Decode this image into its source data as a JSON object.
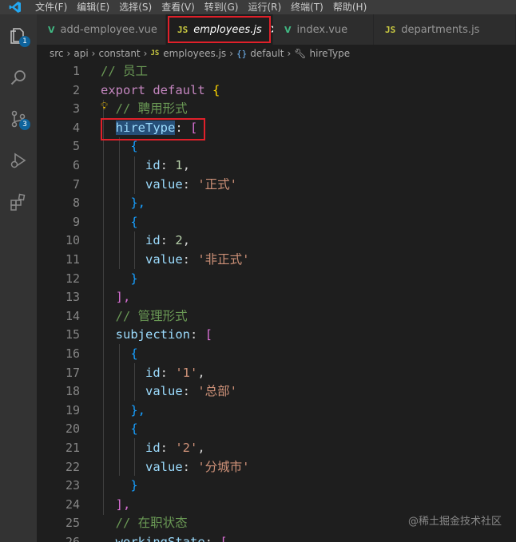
{
  "menubar": {
    "items": [
      "文件(F)",
      "编辑(E)",
      "选择(S)",
      "查看(V)",
      "转到(G)",
      "运行(R)",
      "终端(T)",
      "帮助(H)"
    ]
  },
  "activity": {
    "explorer_badge": "1",
    "scm_badge": "3"
  },
  "tabs": [
    {
      "icon": "V",
      "name": "add-employee.vue",
      "modified": true
    },
    {
      "icon": "JS",
      "name": "employees.js",
      "active": true
    },
    {
      "icon": "V",
      "name": "index.vue"
    },
    {
      "icon": "JS",
      "name": "departments.js"
    }
  ],
  "breadcrumb": {
    "parts": [
      "src",
      "api",
      "constant"
    ],
    "file_icon": "JS",
    "file": "employees.js",
    "symbol_icon": "{}",
    "symbol": "default",
    "leaf": "hireType"
  },
  "code": {
    "line_numbers": [
      "1",
      "2",
      "3",
      "4",
      "5",
      "6",
      "7",
      "8",
      "9",
      "10",
      "11",
      "12",
      "13",
      "14",
      "15",
      "16",
      "17",
      "18",
      "19",
      "20",
      "21",
      "22",
      "23",
      "24",
      "25",
      "26"
    ],
    "l1": "// 员工",
    "l2_kw": "export",
    "l2_kw2": "default",
    "l2_brace": "{",
    "l3": "// 聘用形式",
    "l4_prop": "hireType",
    "l4_rest": ": ",
    "l4_br": "[",
    "l5": "{",
    "l6_prop": "id",
    "l6_sep": ": ",
    "l6_val": "1",
    "l6_end": ",",
    "l7_prop": "value",
    "l7_sep": ": ",
    "l7_val": "'正式'",
    "l8": "},",
    "l9": "{",
    "l10_prop": "id",
    "l10_sep": ": ",
    "l10_val": "2",
    "l10_end": ",",
    "l11_prop": "value",
    "l11_sep": ": ",
    "l11_val": "'非正式'",
    "l12": "}",
    "l13": "],",
    "l14": "// 管理形式",
    "l15_prop": "subjection",
    "l15_sep": ": ",
    "l15_br": "[",
    "l16": "{",
    "l17_prop": "id",
    "l17_sep": ": ",
    "l17_val": "'1'",
    "l17_end": ",",
    "l18_prop": "value",
    "l18_sep": ": ",
    "l18_val": "'总部'",
    "l19": "},",
    "l20": "{",
    "l21_prop": "id",
    "l21_sep": ": ",
    "l21_val": "'2'",
    "l21_end": ",",
    "l22_prop": "value",
    "l22_sep": ": ",
    "l22_val": "'分城市'",
    "l23": "}",
    "l24": "],",
    "l25": "// 在职状态",
    "l26_prop": "workingState",
    "l26_sep": ": ",
    "l26_br": "["
  },
  "watermark": "@稀土掘金技术社区",
  "colors": {
    "keyword": "#c586c0",
    "property": "#9cdcfe",
    "string": "#ce9178",
    "number": "#b5cea8",
    "comment": "#6a9955",
    "highlight_box": "#e0202a"
  }
}
